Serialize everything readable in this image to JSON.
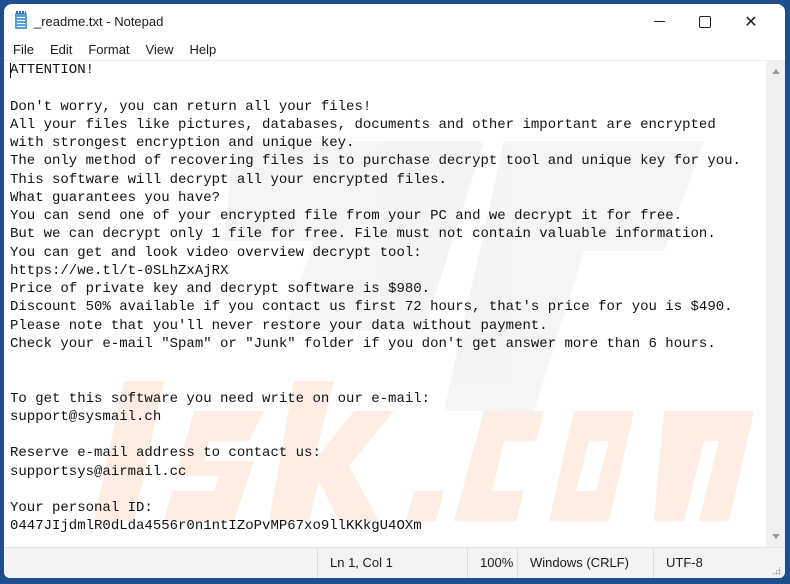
{
  "window": {
    "title": "_readme.txt - Notepad",
    "icon": "notepad-icon",
    "controls": {
      "minimize": "minimize-icon",
      "maximize": "maximize-icon",
      "close": "close-icon",
      "close_glyph": "✕"
    }
  },
  "menu": {
    "items": [
      {
        "label": "File"
      },
      {
        "label": "Edit"
      },
      {
        "label": "Format"
      },
      {
        "label": "View"
      },
      {
        "label": "Help"
      }
    ]
  },
  "editor": {
    "lines": [
      "ATTENTION!",
      "",
      "Don't worry, you can return all your files!",
      "All your files like pictures, databases, documents and other important are encrypted",
      "with strongest encryption and unique key.",
      "The only method of recovering files is to purchase decrypt tool and unique key for you.",
      "This software will decrypt all your encrypted files.",
      "What guarantees you have?",
      "You can send one of your encrypted file from your PC and we decrypt it for free.",
      "But we can decrypt only 1 file for free. File must not contain valuable information.",
      "You can get and look video overview decrypt tool:",
      "https://we.tl/t-0SLhZxAjRX",
      "Price of private key and decrypt software is $980.",
      "Discount 50% available if you contact us first 72 hours, that's price for you is $490.",
      "Please note that you'll never restore your data without payment.",
      "Check your e-mail \"Spam\" or \"Junk\" folder if you don't get answer more than 6 hours.",
      "",
      "",
      "To get this software you need write on our e-mail:",
      "support@sysmail.ch",
      "",
      "Reserve e-mail address to contact us:",
      "supportsys@airmail.cc",
      "",
      "Your personal ID:",
      "0447JIjdmlR0dLda4556r0n1ntIZoPvMP67xo9llKKkgU4OXm"
    ]
  },
  "statusbar": {
    "position": "Ln 1, Col 1",
    "zoom": "100%",
    "line_ending": "Windows (CRLF)",
    "encoding": "UTF-8"
  },
  "colors": {
    "frame": "#1f4e8c",
    "watermark_gray": "#e8e8e8",
    "watermark_orange": "#fbe3d2"
  }
}
